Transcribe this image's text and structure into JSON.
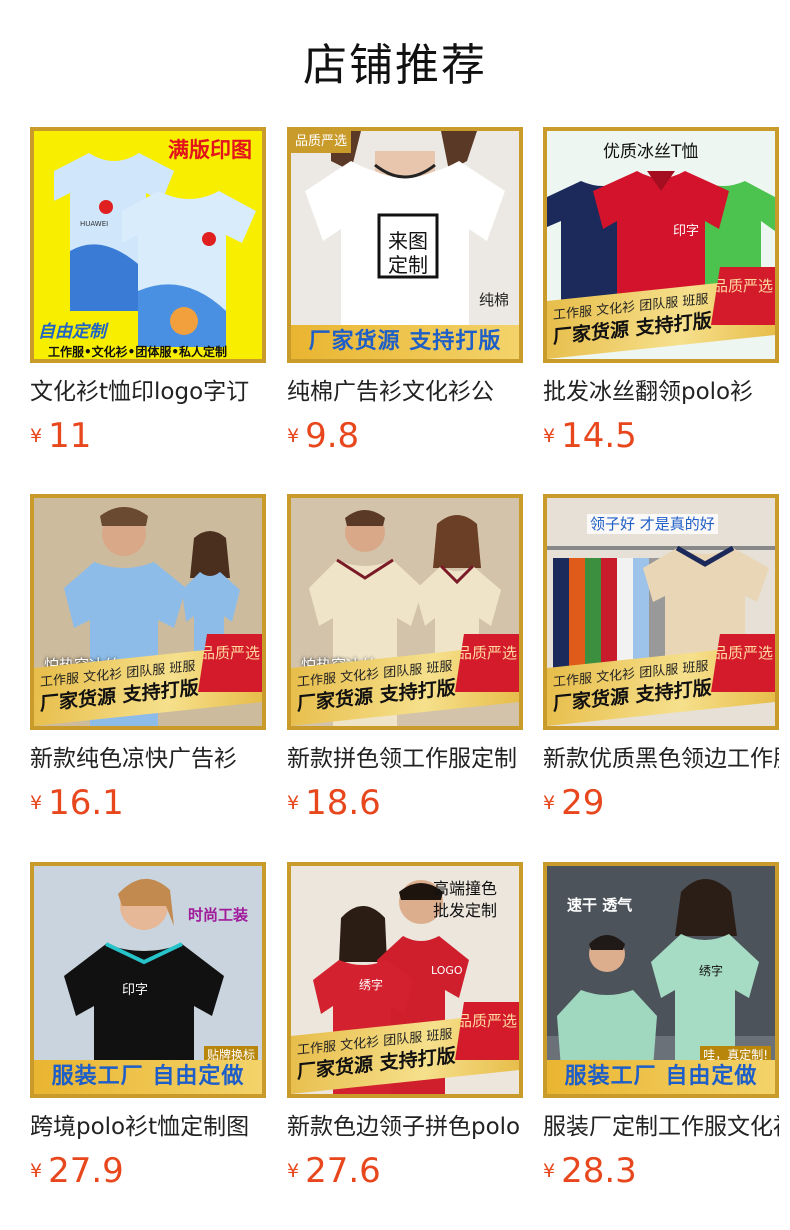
{
  "header": {
    "title": "店铺推荐"
  },
  "currency": "¥",
  "products": [
    {
      "name": "文化衫t恤印logo字订",
      "price": "11",
      "tags": {
        "top": "满版印图",
        "mid": "自由定制",
        "bottom": "工作服•文化衫•团体服•私人定制",
        "brand": "HUAWEI"
      }
    },
    {
      "name": "纯棉广告衫文化衫公",
      "price": "9.8",
      "tags": {
        "corner": "品质严选",
        "sign": "来图定制",
        "fabric": "纯棉",
        "bar": "厂家货源 支持打版"
      }
    },
    {
      "name": "批发冰丝翻领polo衫",
      "price": "14.5",
      "tags": {
        "top": "优质冰丝T恤",
        "print": "印字",
        "factory_small": "工作服 文化衫 团队服 班服",
        "factory": "厂家货源 支持打版",
        "seal": "品质严选"
      }
    },
    {
      "name": "新款纯色凉快广告衫",
      "price": "16.1",
      "tags": {
        "mid": "怕热穿冰丝",
        "factory_small": "工作服 文化衫 团队服 班服",
        "factory": "厂家货源 支持打版",
        "seal": "品质严选"
      }
    },
    {
      "name": "新款拼色领工作服定制",
      "price": "18.6",
      "tags": {
        "mid": "怕热穿冰丝",
        "factory_small": "工作服 文化衫 团队服 班服",
        "factory": "厂家货源 支持打版",
        "seal": "品质严选"
      }
    },
    {
      "name": "新款优质黑色领边工作服",
      "price": "29",
      "tags": {
        "top": "领子好 才是真的好",
        "factory_small": "工作服 文化衫 团队服 班服",
        "factory": "厂家货源 支持打版",
        "seal": "品质严选"
      }
    },
    {
      "name": "跨境polo衫t恤定制图",
      "price": "27.9",
      "tags": {
        "top": "时尚工装",
        "print": "印字",
        "mid": "贴牌换标",
        "bar": "服装工厂 自由定做"
      }
    },
    {
      "name": "新款色边领子拼色polo",
      "price": "27.6",
      "tags": {
        "top": "高端撞色 批发定制",
        "print": "绣字",
        "logo": "LOGO",
        "factory_small": "工作服 文化衫 团队服 班服",
        "factory": "厂家货源 支持打版",
        "seal": "品质严选"
      }
    },
    {
      "name": "服装厂定制工作服文化衫",
      "price": "28.3",
      "tags": {
        "top": "速干 透气",
        "print": "绣字",
        "mid": "哇，真定制!",
        "bar": "服装工厂 自由定做"
      }
    }
  ],
  "colors": {
    "price": "#e8471d",
    "frame": "#c89b2a",
    "bar_text": "#1e5ec8",
    "seal": "#d31b2b"
  }
}
